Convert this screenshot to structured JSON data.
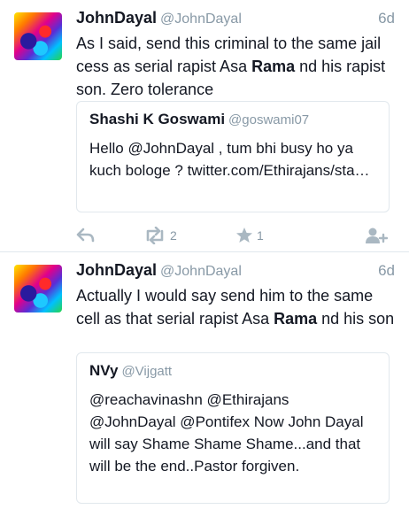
{
  "tweets": [
    {
      "author": "JohnDayal",
      "handle": "@JohnDayal",
      "time": "6d",
      "text_before": "As I said, send this criminal to the same jail cess as serial rapist Asa ",
      "text_bold": "Rama",
      "text_after": " nd his rapist son. Zero tolerance",
      "quote": {
        "author": "Shashi K Goswami",
        "handle": "@goswami07",
        "text": "Hello @JohnDayal , tum bhi busy ho ya kuch bologe ?  twitter.com/Ethirajans/sta…"
      },
      "actions": {
        "reply_icon": "reply-icon",
        "retweet_icon": "retweet-icon",
        "retweet_count": "2",
        "favorite_icon": "star-icon",
        "favorite_count": "1",
        "follow_icon": "follow-icon"
      }
    },
    {
      "author": "JohnDayal",
      "handle": "@JohnDayal",
      "time": "6d",
      "text_before": "Actually I would say send him to the same cell as that serial rapist Asa ",
      "text_bold": "Rama",
      "text_after": " nd his son",
      "quote": {
        "author": "NVy",
        "handle": "@Vijgatt",
        "text": "@reachavinashn @Ethirajans @JohnDayal @Pontifex Now John Dayal will say Shame Shame Shame...and that will be the end..Pastor forgiven."
      }
    }
  ],
  "colors": {
    "text": "#141823",
    "muted": "#8899a6",
    "border": "#e1e8ed",
    "icon": "#aab8c2"
  }
}
